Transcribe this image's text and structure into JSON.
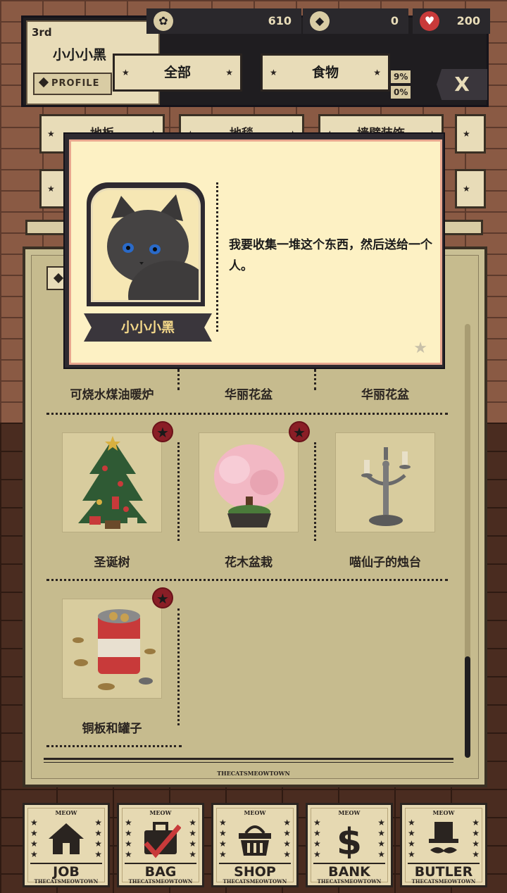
{
  "player": {
    "rank": "3rd",
    "name": "小小小黑",
    "profile_label": "PROFILE"
  },
  "currency": {
    "paws": "610",
    "gems": "0",
    "hearts": "200"
  },
  "percent": {
    "p1": "9%",
    "p2": "0%"
  },
  "close_label": "X",
  "filter_tabs": {
    "all": "全部",
    "food": "食物"
  },
  "sub_tabs": [
    "地板",
    "地毯",
    "墙壁装饰"
  ],
  "dialog": {
    "speaker": "小小小黑",
    "text": "我要收集一堆这个东西，然后送给一个人。"
  },
  "items": [
    {
      "name": "可烧水煤油暖炉",
      "starred": false
    },
    {
      "name": "华丽花盆",
      "starred": false
    },
    {
      "name": "华丽花盆",
      "starred": false
    },
    {
      "name": "圣诞树",
      "starred": true
    },
    {
      "name": "花木盆栽",
      "starred": true
    },
    {
      "name": "喵仙子的烛台",
      "starred": false
    },
    {
      "name": "铜板和罐子",
      "starred": true
    }
  ],
  "brand": "THECATSMEOWTOWN",
  "nav": {
    "meow": "MEOW",
    "job": "JOB",
    "bag": "BAG",
    "shop": "SHOP",
    "bank": "BANK",
    "butler": "BUTLER",
    "sub": "THECATSMEOWTOWN"
  },
  "colors": {
    "panel": "#c9bf94",
    "dialog_bg": "#fdf1c4",
    "badge": "#8a1e26",
    "accent_dark": "#2e2a30"
  }
}
